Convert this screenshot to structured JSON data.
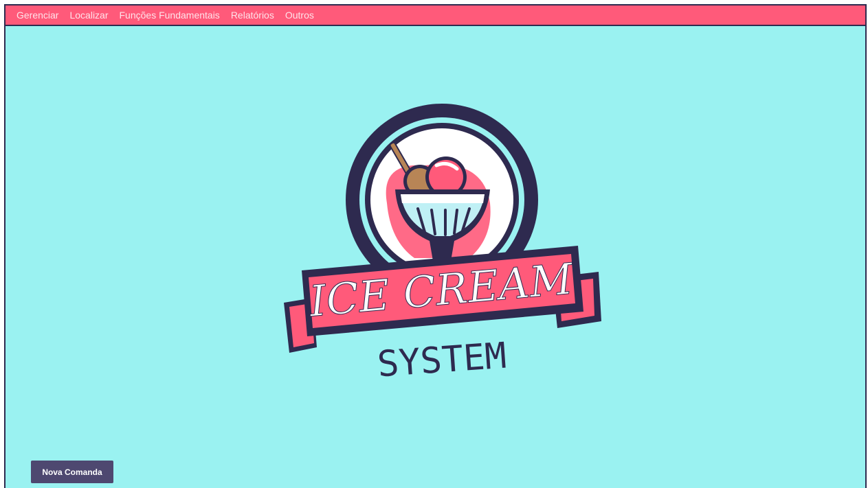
{
  "menu": {
    "items": [
      {
        "label": "Gerenciar"
      },
      {
        "label": "Localizar"
      },
      {
        "label": "Funções Fundamentais"
      },
      {
        "label": "Relatórios"
      },
      {
        "label": "Outros"
      }
    ]
  },
  "logo": {
    "title_line1": "ICE CREAM",
    "title_line2": "SYSTEM",
    "icon": "ice-cream-sundae-icon"
  },
  "actions": {
    "new_order_label": "Nova Comanda"
  },
  "colors": {
    "background": "#9af2f1",
    "menubar": "#ff5a7a",
    "dark": "#2e2a4f",
    "button": "#4e4870",
    "accent_pink": "#ff5a7a",
    "cream": "#ffffff"
  }
}
